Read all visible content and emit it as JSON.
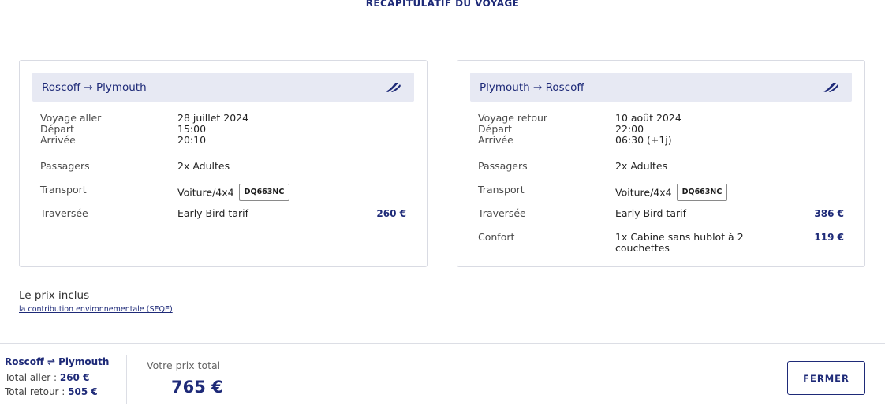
{
  "page_title": "RÉCAPITULATIF DU VOYAGE",
  "outbound": {
    "route": "Roscoff → Plymouth",
    "brand_icon": "ferry-brand-logo-icon",
    "voyage_label": "Voyage aller",
    "voyage_date": "28 juillet 2024",
    "depart_label": "Départ",
    "depart_time": "15:00",
    "arrivee_label": "Arrivée",
    "arrivee_time": "20:10",
    "passagers_label": "Passagers",
    "passagers_value": "2x Adultes",
    "transport_label": "Transport",
    "transport_value": "Voiture/4x4",
    "plate": "DQ663NC",
    "traversee_label": "Traversée",
    "traversee_value": "Early Bird tarif",
    "traversee_price": "260 €"
  },
  "return": {
    "route": "Plymouth → Roscoff",
    "brand_icon": "ferry-brand-logo-icon",
    "voyage_label": "Voyage retour",
    "voyage_date": "10 août 2024",
    "depart_label": "Départ",
    "depart_time": "22:00",
    "arrivee_label": "Arrivée",
    "arrivee_time": "06:30 (+1j)",
    "passagers_label": "Passagers",
    "passagers_value": "2x Adultes",
    "transport_label": "Transport",
    "transport_value": "Voiture/4x4",
    "plate": "DQ663NC",
    "traversee_label": "Traversée",
    "traversee_value": "Early Bird tarif",
    "traversee_price": "386 €",
    "confort_label": "Confort",
    "confort_value": "1x Cabine sans hublot à 2 couchettes",
    "confort_price": "119 €"
  },
  "price_includes": {
    "title": "Le prix inclus",
    "link": "la contribution environnementale (SEQE)"
  },
  "footer": {
    "route": "Roscoff ⇌ Plymouth",
    "total_aller_label": "Total aller : ",
    "total_aller_value": "260 €",
    "total_retour_label": "Total retour : ",
    "total_retour_value": "505 €",
    "total_label": "Votre prix total",
    "total_value": "765 €",
    "close_label": "FERMER"
  },
  "colors": {
    "brand_navy": "#1e2a78",
    "header_bg": "#e7e9f3",
    "border": "#d9dbe3"
  }
}
